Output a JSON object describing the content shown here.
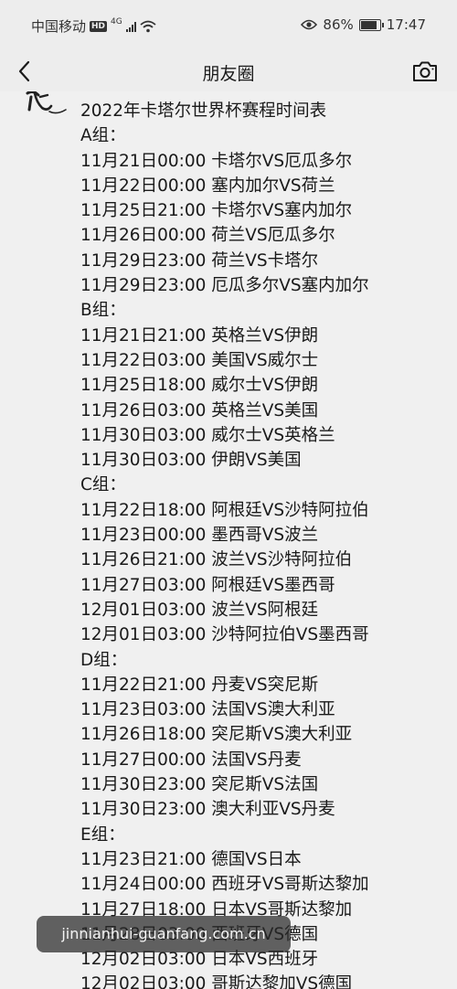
{
  "status_bar": {
    "carrier": "中国移动",
    "network_badge": "HD",
    "network_type": "4G",
    "battery": "86%",
    "battery_level": 0.86,
    "time": "17:47"
  },
  "nav": {
    "title": "朋友圈"
  },
  "post": {
    "title": "2022年卡塔尔世界杯赛程时间表",
    "groups": [
      {
        "label": "A组：",
        "matches": [
          "11月21日00:00 卡塔尔VS厄瓜多尔",
          "11月22日00:00 塞内加尔VS荷兰",
          "11月25日21:00 卡塔尔VS塞内加尔",
          "11月26日00:00 荷兰VS厄瓜多尔",
          "11月29日23:00 荷兰VS卡塔尔",
          "11月29日23:00 厄瓜多尔VS塞内加尔"
        ]
      },
      {
        "label": "B组：",
        "matches": [
          "11月21日21:00 英格兰VS伊朗",
          "11月22日03:00 美国VS威尔士",
          "11月25日18:00 威尔士VS伊朗",
          "11月26日03:00 英格兰VS美国",
          "11月30日03:00 威尔士VS英格兰",
          "11月30日03:00 伊朗VS美国"
        ]
      },
      {
        "label": "C组：",
        "matches": [
          "11月22日18:00 阿根廷VS沙特阿拉伯",
          "11月23日00:00 墨西哥VS波兰",
          "11月26日21:00 波兰VS沙特阿拉伯",
          "11月27日03:00 阿根廷VS墨西哥",
          "12月01日03:00 波兰VS阿根廷",
          "12月01日03:00 沙特阿拉伯VS墨西哥"
        ]
      },
      {
        "label": "D组：",
        "matches": [
          "11月22日21:00 丹麦VS突尼斯",
          "11月23日03:00 法国VS澳大利亚",
          "11月26日18:00 突尼斯VS澳大利亚",
          "11月27日00:00 法国VS丹麦",
          "11月30日23:00 突尼斯VS法国",
          "11月30日23:00 澳大利亚VS丹麦"
        ]
      },
      {
        "label": "E组：",
        "matches": [
          "11月23日21:00 德国VS日本",
          "11月24日00:00 西班牙VS哥斯达黎加",
          "11月27日18:00 日本VS哥斯达黎加",
          "11月28日03:00 西班牙VS德国",
          "12月02日03:00 日本VS西班牙",
          "12月02日03:00 哥斯达黎加VS德国"
        ]
      }
    ]
  },
  "watermark": "jinnianhui-guanfang.com.cn"
}
